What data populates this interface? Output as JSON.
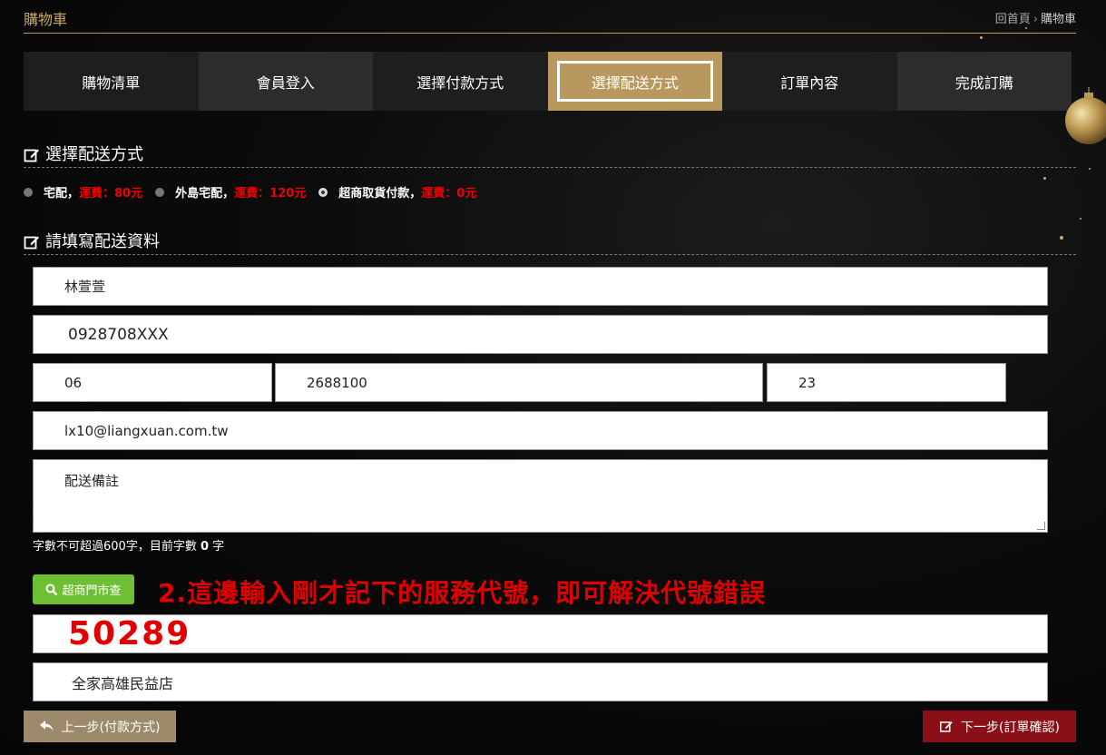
{
  "header": {
    "title": "購物車",
    "breadcrumb_home": "回首頁",
    "breadcrumb_sep": "›",
    "breadcrumb_current": "購物車"
  },
  "steps": [
    {
      "label": "購物清單"
    },
    {
      "label": "會員登入"
    },
    {
      "label": "選擇付款方式"
    },
    {
      "label": "選擇配送方式"
    },
    {
      "label": "訂單內容"
    },
    {
      "label": "完成訂購"
    }
  ],
  "shipping": {
    "title": "選擇配送方式",
    "options": [
      {
        "label": "宅配，",
        "fee": "運費：80元",
        "selected": false
      },
      {
        "label": "外島宅配，",
        "fee": "運費：120元",
        "selected": false
      },
      {
        "label": "超商取貨付款，",
        "fee": "運費：0元",
        "selected": true
      }
    ]
  },
  "form": {
    "title": "請填寫配送資料",
    "name": "林萱萱",
    "mobile": "0928708XXX",
    "phone_area": "06",
    "phone_number": "2688100",
    "phone_ext": "23",
    "email": "lx10@liangxuan.com.tw",
    "note_placeholder": "配送備註",
    "hint_prefix": "字數不可超過600字，目前字數 ",
    "hint_count": "0",
    "hint_suffix": " 字",
    "store_search_label": "超商門市查",
    "annotation": "2.這邊輸入剛才記下的服務代號，即可解決代號錯誤",
    "store_code": "50289",
    "store_name": "全家高雄民益店"
  },
  "buttons": {
    "prev": "上一步(付款方式)",
    "next": "下一步(訂單確認)"
  },
  "colors": {
    "gold": "#b8985c",
    "red_fee": "#ee0000",
    "green": "#6fbf35",
    "next_btn": "#8b0f17",
    "prev_btn": "#9c8a6a"
  }
}
